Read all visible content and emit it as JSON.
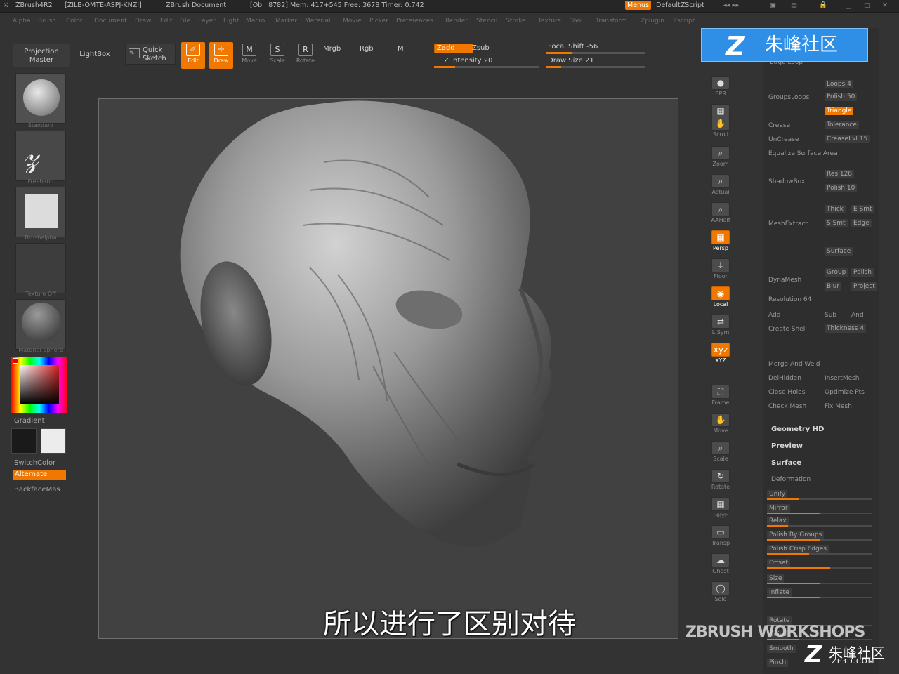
{
  "titlebar": {
    "app": "ZBrush4R2",
    "license": "[ZILB-OMTE-ASPJ-KNZI]",
    "document": "ZBrush Document",
    "stats": "[Obj: 8782] Mem: 417+545 Free: 3678 Timer: 0.742",
    "menus_btn": "Menus",
    "script": "DefaultZScript"
  },
  "menubar": [
    "Alpha",
    "Brush",
    "Color",
    "Document",
    "Draw",
    "Edit",
    "File",
    "Layer",
    "Light",
    "Macro",
    "Marker",
    "Material",
    "Movie",
    "Picker",
    "Preferences",
    "Render",
    "Stencil",
    "Stroke",
    "Texture",
    "Tool",
    "Transform",
    "Zplugin",
    "Zscript"
  ],
  "toolbar": {
    "projection_master": "Projection Master",
    "lightbox": "LightBox",
    "quick_sketch": "Quick Sketch",
    "edit": "Edit",
    "draw": "Draw",
    "move": "Move",
    "scale": "Scale",
    "rotate": "Rotate",
    "mrgb": "Mrgb",
    "rgb": "Rgb",
    "m": "M",
    "zadd": "Zadd",
    "zsub": "Zsub",
    "z_intensity": "Z Intensity 20",
    "focal_shift": "Focal Shift -56",
    "draw_size": "Draw Size 21",
    "z_intensity_fill": 0.2,
    "draw_size_fill": 0.15
  },
  "leftshelf": {
    "items": [
      "Standard",
      "Freehand",
      "Brushalpha",
      "Texture Off",
      "Material Sphere"
    ],
    "gradient": "Gradient",
    "switchcolor": "SwitchColor",
    "alternate": "Alternate",
    "backface": "BackfaceMas"
  },
  "rightshelf": [
    "BPR",
    "SPix",
    "Scroll",
    "Zoom",
    "Actual",
    "AAHalf",
    "Persp",
    "Floor",
    "Local",
    "L.Sym",
    "XYZ",
    "Frame",
    "Move",
    "Scale",
    "Rotate",
    "PolyF",
    "Transp",
    "Ghost",
    "Solo"
  ],
  "panel": {
    "edge_loop": "Edge Loop",
    "loops": "Loops 4",
    "groupsloops": "GroupsLoops",
    "polish": "Polish 50",
    "triangle": "Triangle",
    "crease": "Crease",
    "tolerance": "Tolerance",
    "uncrease": "UnCrease",
    "crease_lvl": "CreaseLvl 15",
    "equalize": "Equalize Surface Area",
    "shadowbox": "ShadowBox",
    "res": "Res 128",
    "polish2": "Polish 10",
    "mesh_extract": "MeshExtract",
    "thick": "Thick",
    "e_smt": "E Smt",
    "s_smt": "S Smt",
    "edge": "Edge",
    "surface": "Surface",
    "dynamesh": "DynaMesh",
    "group": "Group",
    "polish3": "Polish",
    "blur": "Blur",
    "project": "Project",
    "resolution": "Resolution 64",
    "add": "Add",
    "sub": "Sub",
    "and": "And",
    "create_shell": "Create Shell",
    "thickness": "Thickness 4",
    "merge_hid": "Merge And Weld",
    "del_hidden": "DelHidden",
    "insert_mesh": "InsertMesh",
    "close_holes": "Close Holes",
    "optimize": "Optimize Pts",
    "check_mesh": "Check Mesh",
    "fix_mesh": "Fix Mesh",
    "geometry_hd": "Geometry HD",
    "preview": "Preview",
    "surface2": "Surface",
    "deformation": "Deformation",
    "unify": "Unify",
    "mirror": "Mirror",
    "relax": "Relax",
    "polish_groups": "Polish By Groups",
    "polish_crisp": "Polish Crisp Edges",
    "offset": "Offset",
    "size": "Size",
    "inflate": "Inflate",
    "rotate": "Rotate",
    "noise": "Noise",
    "smooth": "Smooth",
    "pinch": "Pinch",
    "deform_values": [
      0.3,
      0.5,
      0.2,
      0.5,
      0.4,
      0.6,
      0.5,
      0.5,
      0.5,
      0.3
    ]
  },
  "subtitle": "所以进行了区别对待",
  "watermarks": {
    "logo_text": "朱峰社区",
    "workshops": "ZBRUSH WORKSHOPS",
    "zf_cn": "朱峰社区",
    "zf_url": "ZF3D.COM"
  },
  "colors": {
    "accent": "#f07800",
    "bg": "#333333",
    "canvas": "#414141",
    "primary_color": "#1a1a1a",
    "secondary_color": "#ececec"
  }
}
